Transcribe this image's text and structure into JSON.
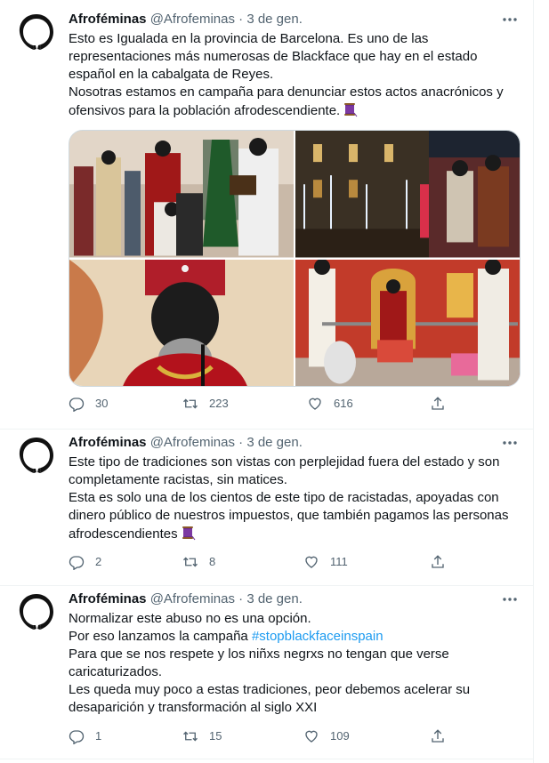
{
  "tweets": [
    {
      "name": "Afroféminas",
      "handle": "@Afrofeminas",
      "separator": "·",
      "date": "3 de gen.",
      "paragraphs": [
        "Esto es Igualada en la provincia de Barcelona. Es uno de las representaciones más numerosas de Blackface que hay en el estado español en la cabalgata de Reyes.",
        "Nosotras estamos en campaña para denunciar estos actos anacrónicos y ofensivos para la población  afrodescendiente."
      ],
      "replies": "30",
      "retweets": "223",
      "likes": "616"
    },
    {
      "name": "Afroféminas",
      "handle": "@Afrofeminas",
      "separator": "·",
      "date": "3 de gen.",
      "paragraphs": [
        "Este tipo de tradiciones son vistas con perplejidad fuera del estado y son completamente racistas, sin matices.",
        "Esta es solo una de los cientos de este tipo de racistadas, apoyadas con dinero público de nuestros impuestos, que también pagamos las personas afrodescendientes"
      ],
      "replies": "2",
      "retweets": "8",
      "likes": "111"
    },
    {
      "name": "Afroféminas",
      "handle": "@Afrofeminas",
      "separator": "·",
      "date": "3 de gen.",
      "line1": "Normalizar este abuso no es una opción.",
      "line2_prefix": "Por eso lanzamos la campaña ",
      "hashtag": "#stopblackfaceinspain",
      "line3": "Para que se nos respete y los niñxs negrxs no tengan que verse caricaturizados.",
      "line4": "Les queda muy poco a estas tradiciones, peor debemos acelerar su desaparición y transformación al siglo XXI",
      "replies": "1",
      "retweets": "15",
      "likes": "109"
    }
  ],
  "icons": {
    "avatar": "afrofeminas-logo",
    "more": "more-dots-icon",
    "reply": "reply-icon",
    "retweet": "retweet-icon",
    "like": "heart-icon",
    "share": "share-icon",
    "emoji": "purple-thread-emoji"
  },
  "colors": {
    "text": "#0f1419",
    "muted": "#536471",
    "link": "#1d9bf0",
    "border": "#eff3f4"
  }
}
